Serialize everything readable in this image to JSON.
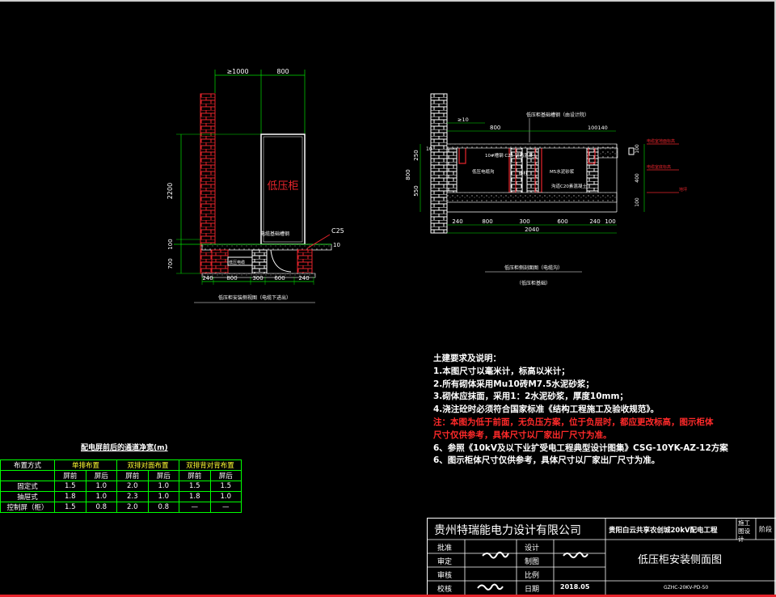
{
  "drawing": {
    "left_view": {
      "cabinet_label": "低压柜",
      "dim_top": [
        "≥1000",
        "800"
      ],
      "dim_height": [
        "2200",
        "700",
        "100"
      ],
      "dim_bottom": [
        "240",
        "800",
        "300",
        "600",
        "240"
      ],
      "c25_label": "C25",
      "ten_label": "10",
      "base_label": "电缆基础槽钢",
      "trench_label": "低压电缆",
      "caption": "低压柜安装侧视图（电缆下进出）"
    },
    "right_view": {
      "top_label": "低压柜基础槽钢（由设计院）",
      "dim_top": [
        "≥10",
        "800",
        "100140"
      ],
      "label_steel": "10#槽钢 C25 钢筋混凝土",
      "label_cable_trench": "低压电缆沟",
      "label_pillar": "砖柱",
      "label_mortar": "M5水泥砂浆",
      "label_concrete": "沟道C20素混凝土",
      "dim_left": [
        "800",
        "550",
        "250",
        "10"
      ],
      "dim_right": [
        "100",
        "400",
        "100"
      ],
      "right_notes": [
        "电缆室地面标高",
        "电缆室底标高",
        "地坪"
      ],
      "dim_bottom_a": [
        "240",
        "800",
        "300",
        "600",
        "240",
        "100"
      ],
      "dim_bottom_b": "2040",
      "caption": "低压柜侧剖面图（电缆沟）",
      "sub_caption": "（低压柜基础）"
    },
    "notes": {
      "title": "土建要求及说明：",
      "lines": [
        "1.本图尺寸以毫米计，标高以米计；",
        "2.所有砌体采用Mu10砖M7.5水泥砂浆；",
        "3.砌体应抹面，采用1：2水泥砂浆，厚度10mm；",
        "4.浇注砼时必须符合国家标准《结构工程施工及验收规范》。",
        "6、参照《10kV及以下业扩受电工程典型设计图集》CSG-10YK-AZ-12方案",
        "6、图示柜体尺寸仅供参考，具体尺寸以厂家出厂尺寸为准。"
      ],
      "red_line": "注：本图为低于前面，无负压方案，位于负层时，都应更改标高，图示柜体尺寸仅供参考，具体尺寸以厂家出厂尺寸为准。"
    },
    "table": {
      "title": "配电屏前后的通道净宽(m)",
      "header": [
        "布置方式",
        "单排布置",
        "双排对面布置",
        "双排背对背布置"
      ],
      "subheader": [
        "屏前",
        "屏后",
        "屏前",
        "屏后",
        "屏前",
        "屏后"
      ],
      "rows": [
        {
          "name": "固定式",
          "vals": [
            "1.5",
            "1.0",
            "2.0",
            "1.0",
            "1.5",
            "1.5"
          ]
        },
        {
          "name": "抽屉式",
          "vals": [
            "1.8",
            "1.0",
            "2.3",
            "1.0",
            "1.8",
            "1.0"
          ]
        },
        {
          "name": "控制屏（柜）",
          "vals": [
            "1.5",
            "0.8",
            "2.0",
            "0.8",
            "—",
            "—"
          ]
        }
      ]
    },
    "title_block": {
      "company": "贵州特瑞能电力设计有限公司",
      "project": "贵阳白云共享农创城20kV配电工程",
      "stage_label": "施工图设计",
      "stage_suffix": "阶段",
      "rows_left": [
        "批准",
        "审定",
        "审核",
        "校核"
      ],
      "rows_mid": [
        "设计",
        "制图",
        "比例",
        "日期"
      ],
      "date": "2018.05",
      "drawing_title": "低压柜安装侧面图",
      "drawing_no": "GZHC-20KV-PD-50"
    },
    "colors": {
      "brick": "#e8242c",
      "dim": "#00e000",
      "outline": "#ffffff",
      "text_dim": "#ffffff",
      "note_red": "#ff2a2a",
      "table_border": "#00ff00",
      "table_header": "#ffff33"
    }
  }
}
